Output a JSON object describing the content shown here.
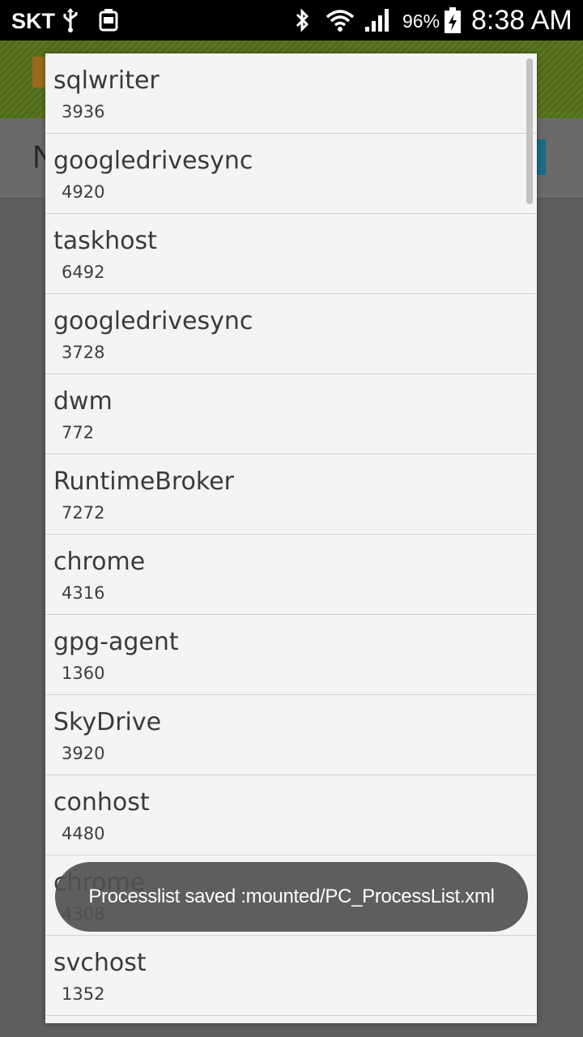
{
  "status_bar": {
    "carrier": "SKT",
    "battery_percent": "96%",
    "time": "8:38 AM",
    "icons": [
      "usb-icon",
      "device-icon",
      "bluetooth-icon",
      "wifi-icon",
      "signal-icon",
      "battery-charging-icon"
    ]
  },
  "background_app": {
    "subbar_letter": "N"
  },
  "process_list": [
    {
      "name": "sqlwriter",
      "pid": "3936"
    },
    {
      "name": "googledrivesync",
      "pid": "4920"
    },
    {
      "name": "taskhost",
      "pid": "6492"
    },
    {
      "name": "googledrivesync",
      "pid": "3728"
    },
    {
      "name": "dwm",
      "pid": "772"
    },
    {
      "name": "RuntimeBroker",
      "pid": "7272"
    },
    {
      "name": "chrome",
      "pid": "4316"
    },
    {
      "name": "gpg-agent",
      "pid": "1360"
    },
    {
      "name": "SkyDrive",
      "pid": "3920"
    },
    {
      "name": "conhost",
      "pid": "4480"
    },
    {
      "name": "chrome",
      "pid": "4308"
    },
    {
      "name": "svchost",
      "pid": "1352"
    }
  ],
  "toast": {
    "message": "Processlist saved :mounted/PC_ProcessList.xml"
  },
  "colors": {
    "status_bar_bg": "#000000",
    "header_green": "#5a771f",
    "dialog_bg": "#f4f4f4",
    "divider": "#d3d3d3",
    "toast_bg": "#505050"
  }
}
